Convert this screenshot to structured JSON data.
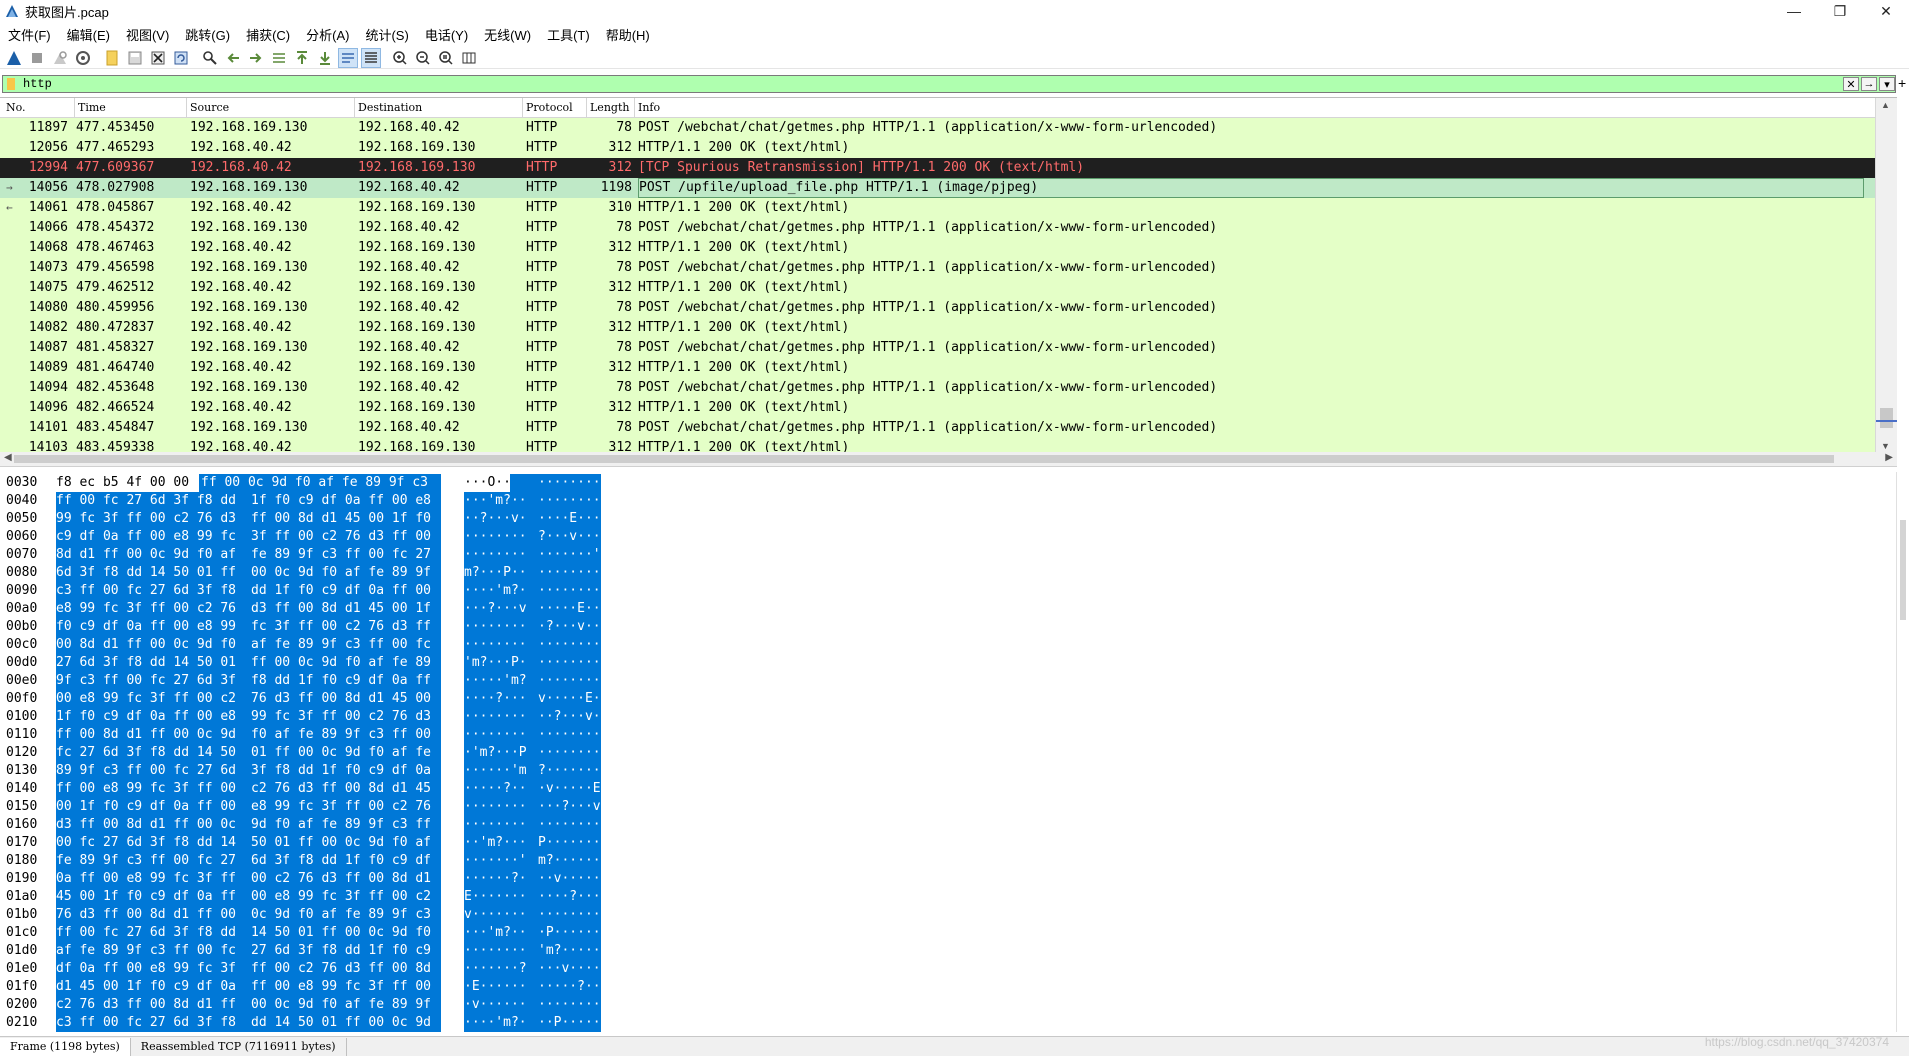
{
  "window": {
    "title": "获取图片.pcap",
    "controls": {
      "minimize": "—",
      "restore": "❐",
      "close": "✕"
    }
  },
  "menu": [
    "文件(F)",
    "编辑(E)",
    "视图(V)",
    "跳转(G)",
    "捕获(C)",
    "分析(A)",
    "统计(S)",
    "电话(Y)",
    "无线(W)",
    "工具(T)",
    "帮助(H)"
  ],
  "toolbar": {
    "icons": [
      "shark-fin-start-icon",
      "stop-icon",
      "restart-icon",
      "options-icon",
      "open-file-icon",
      "save-icon",
      "close-file-icon",
      "reload-icon",
      "find-icon",
      "go-back-icon",
      "go-forward-icon",
      "go-to-packet-icon",
      "first-packet-icon",
      "last-packet-icon",
      "autoscroll-icon",
      "colorize-icon",
      "zoom-in-icon",
      "zoom-out-icon",
      "zoom-normal-icon",
      "resize-columns-icon"
    ]
  },
  "filter": {
    "value": "http",
    "clear_icon": "✕",
    "apply_icon": "→"
  },
  "packet_list": {
    "columns": {
      "no": "No.",
      "time": "Time",
      "source": "Source",
      "destination": "Destination",
      "protocol": "Protocol",
      "length": "Length",
      "info": "Info"
    },
    "rows": [
      {
        "no": "11897",
        "time": "477.453450",
        "src": "192.168.169.130",
        "dst": "192.168.40.42",
        "proto": "HTTP",
        "len": "78",
        "info": "POST /webchat/chat/getmes.php HTTP/1.1  (application/x-www-form-urlencoded)"
      },
      {
        "no": "12056",
        "time": "477.465293",
        "src": "192.168.40.42",
        "dst": "192.168.169.130",
        "proto": "HTTP",
        "len": "312",
        "info": "HTTP/1.1 200 OK  (text/html)"
      },
      {
        "no": "12994",
        "time": "477.609367",
        "src": "192.168.40.42",
        "dst": "192.168.169.130",
        "proto": "HTTP",
        "len": "312",
        "info": "[TCP Spurious Retransmission] HTTP/1.1 200 OK  (text/html)"
      },
      {
        "no": "14056",
        "time": "478.027908",
        "src": "192.168.169.130",
        "dst": "192.168.40.42",
        "proto": "HTTP",
        "len": "1198",
        "info": "POST /upfile/upload_file.php HTTP/1.1  (image/pjpeg)"
      },
      {
        "no": "14061",
        "time": "478.045867",
        "src": "192.168.40.42",
        "dst": "192.168.169.130",
        "proto": "HTTP",
        "len": "310",
        "info": "HTTP/1.1 200 OK  (text/html)"
      },
      {
        "no": "14066",
        "time": "478.454372",
        "src": "192.168.169.130",
        "dst": "192.168.40.42",
        "proto": "HTTP",
        "len": "78",
        "info": "POST /webchat/chat/getmes.php HTTP/1.1  (application/x-www-form-urlencoded)"
      },
      {
        "no": "14068",
        "time": "478.467463",
        "src": "192.168.40.42",
        "dst": "192.168.169.130",
        "proto": "HTTP",
        "len": "312",
        "info": "HTTP/1.1 200 OK  (text/html)"
      },
      {
        "no": "14073",
        "time": "479.456598",
        "src": "192.168.169.130",
        "dst": "192.168.40.42",
        "proto": "HTTP",
        "len": "78",
        "info": "POST /webchat/chat/getmes.php HTTP/1.1  (application/x-www-form-urlencoded)"
      },
      {
        "no": "14075",
        "time": "479.462512",
        "src": "192.168.40.42",
        "dst": "192.168.169.130",
        "proto": "HTTP",
        "len": "312",
        "info": "HTTP/1.1 200 OK  (text/html)"
      },
      {
        "no": "14080",
        "time": "480.459956",
        "src": "192.168.169.130",
        "dst": "192.168.40.42",
        "proto": "HTTP",
        "len": "78",
        "info": "POST /webchat/chat/getmes.php HTTP/1.1  (application/x-www-form-urlencoded)"
      },
      {
        "no": "14082",
        "time": "480.472837",
        "src": "192.168.40.42",
        "dst": "192.168.169.130",
        "proto": "HTTP",
        "len": "312",
        "info": "HTTP/1.1 200 OK  (text/html)"
      },
      {
        "no": "14087",
        "time": "481.458327",
        "src": "192.168.169.130",
        "dst": "192.168.40.42",
        "proto": "HTTP",
        "len": "78",
        "info": "POST /webchat/chat/getmes.php HTTP/1.1  (application/x-www-form-urlencoded)"
      },
      {
        "no": "14089",
        "time": "481.464740",
        "src": "192.168.40.42",
        "dst": "192.168.169.130",
        "proto": "HTTP",
        "len": "312",
        "info": "HTTP/1.1 200 OK  (text/html)"
      },
      {
        "no": "14094",
        "time": "482.453648",
        "src": "192.168.169.130",
        "dst": "192.168.40.42",
        "proto": "HTTP",
        "len": "78",
        "info": "POST /webchat/chat/getmes.php HTTP/1.1  (application/x-www-form-urlencoded)"
      },
      {
        "no": "14096",
        "time": "482.466524",
        "src": "192.168.40.42",
        "dst": "192.168.169.130",
        "proto": "HTTP",
        "len": "312",
        "info": "HTTP/1.1 200 OK  (text/html)"
      },
      {
        "no": "14101",
        "time": "483.454847",
        "src": "192.168.169.130",
        "dst": "192.168.40.42",
        "proto": "HTTP",
        "len": "78",
        "info": "POST /webchat/chat/getmes.php HTTP/1.1  (application/x-www-form-urlencoded)"
      },
      {
        "no": "14103",
        "time": "483.459338",
        "src": "192.168.40.42",
        "dst": "192.168.169.130",
        "proto": "HTTP",
        "len": "312",
        "info": "HTTP/1.1 200 OK  (text/html)"
      }
    ]
  },
  "bytes": {
    "lines": [
      {
        "off": "0030",
        "pre": "f8 ec b5 4f 00 00",
        "h1": "",
        "h2": "ff 00  0c 9d f0 af fe 89 9f c3",
        "a1": "···O··",
        "a2": " ········"
      },
      {
        "off": "0040",
        "h1": "ff 00 fc 27 6d 3f f8 dd",
        "h2": "1f f0 c9 df 0a ff 00 e8",
        "a1": "···'m?··",
        "a2": " ········"
      },
      {
        "off": "0050",
        "h1": "99 fc 3f ff 00 c2 76 d3",
        "h2": "ff 00 8d d1 45 00 1f f0",
        "a1": "··?···v·",
        "a2": " ····E···"
      },
      {
        "off": "0060",
        "h1": "c9 df 0a ff 00 e8 99 fc",
        "h2": "3f ff 00 c2 76 d3 ff 00",
        "a1": "········",
        "a2": " ?···v···"
      },
      {
        "off": "0070",
        "h1": "8d d1 ff 00 0c 9d f0 af",
        "h2": "fe 89 9f c3 ff 00 fc 27",
        "a1": "········",
        "a2": " ·······'"
      },
      {
        "off": "0080",
        "h1": "6d 3f f8 dd 14 50 01 ff",
        "h2": "00 0c 9d f0 af fe 89 9f",
        "a1": "m?···P··",
        "a2": " ········"
      },
      {
        "off": "0090",
        "h1": "c3 ff 00 fc 27 6d 3f f8",
        "h2": "dd 1f f0 c9 df 0a ff 00",
        "a1": "····'m?·",
        "a2": " ········"
      },
      {
        "off": "00a0",
        "h1": "e8 99 fc 3f ff 00 c2 76",
        "h2": "d3 ff 00 8d d1 45 00 1f",
        "a1": "···?···v",
        "a2": " ·····E··"
      },
      {
        "off": "00b0",
        "h1": "f0 c9 df 0a ff 00 e8 99",
        "h2": "fc 3f ff 00 c2 76 d3 ff",
        "a1": "········",
        "a2": " ·?···v··"
      },
      {
        "off": "00c0",
        "h1": "00 8d d1 ff 00 0c 9d f0",
        "h2": "af fe 89 9f c3 ff 00 fc",
        "a1": "········",
        "a2": " ········"
      },
      {
        "off": "00d0",
        "h1": "27 6d 3f f8 dd 14 50 01",
        "h2": "ff 00 0c 9d f0 af fe 89",
        "a1": "'m?···P·",
        "a2": " ········"
      },
      {
        "off": "00e0",
        "h1": "9f c3 ff 00 fc 27 6d 3f",
        "h2": "f8 dd 1f f0 c9 df 0a ff",
        "a1": "·····'m?",
        "a2": " ········"
      },
      {
        "off": "00f0",
        "h1": "00 e8 99 fc 3f ff 00 c2",
        "h2": "76 d3 ff 00 8d d1 45 00",
        "a1": "····?···",
        "a2": " v·····E·"
      },
      {
        "off": "0100",
        "h1": "1f f0 c9 df 0a ff 00 e8",
        "h2": "99 fc 3f ff 00 c2 76 d3",
        "a1": "········",
        "a2": " ··?···v·"
      },
      {
        "off": "0110",
        "h1": "ff 00 8d d1 ff 00 0c 9d",
        "h2": "f0 af fe 89 9f c3 ff 00",
        "a1": "········",
        "a2": " ········"
      },
      {
        "off": "0120",
        "h1": "fc 27 6d 3f f8 dd 14 50",
        "h2": "01 ff 00 0c 9d f0 af fe",
        "a1": "·'m?···P",
        "a2": " ········"
      },
      {
        "off": "0130",
        "h1": "89 9f c3 ff 00 fc 27 6d",
        "h2": "3f f8 dd 1f f0 c9 df 0a",
        "a1": "······'m",
        "a2": " ?·······"
      },
      {
        "off": "0140",
        "h1": "ff 00 e8 99 fc 3f ff 00",
        "h2": "c2 76 d3 ff 00 8d d1 45",
        "a1": "·····?··",
        "a2": " ·v·····E"
      },
      {
        "off": "0150",
        "h1": "00 1f f0 c9 df 0a ff 00",
        "h2": "e8 99 fc 3f ff 00 c2 76",
        "a1": "········",
        "a2": " ···?···v"
      },
      {
        "off": "0160",
        "h1": "d3 ff 00 8d d1 ff 00 0c",
        "h2": "9d f0 af fe 89 9f c3 ff",
        "a1": "········",
        "a2": " ········"
      },
      {
        "off": "0170",
        "h1": "00 fc 27 6d 3f f8 dd 14",
        "h2": "50 01 ff 00 0c 9d f0 af",
        "a1": "··'m?···",
        "a2": " P·······"
      },
      {
        "off": "0180",
        "h1": "fe 89 9f c3 ff 00 fc 27",
        "h2": "6d 3f f8 dd 1f f0 c9 df",
        "a1": "·······'",
        "a2": " m?······"
      },
      {
        "off": "0190",
        "h1": "0a ff 00 e8 99 fc 3f ff",
        "h2": "00 c2 76 d3 ff 00 8d d1",
        "a1": "······?·",
        "a2": " ··v·····"
      },
      {
        "off": "01a0",
        "h1": "45 00 1f f0 c9 df 0a ff",
        "h2": "00 e8 99 fc 3f ff 00 c2",
        "a1": "E·······",
        "a2": " ····?···"
      },
      {
        "off": "01b0",
        "h1": "76 d3 ff 00 8d d1 ff 00",
        "h2": "0c 9d f0 af fe 89 9f c3",
        "a1": "v·······",
        "a2": " ········"
      },
      {
        "off": "01c0",
        "h1": "ff 00 fc 27 6d 3f f8 dd",
        "h2": "14 50 01 ff 00 0c 9d f0",
        "a1": "···'m?··",
        "a2": " ·P······"
      },
      {
        "off": "01d0",
        "h1": "af fe 89 9f c3 ff 00 fc",
        "h2": "27 6d 3f f8 dd 1f f0 c9",
        "a1": "········",
        "a2": " 'm?·····"
      },
      {
        "off": "01e0",
        "h1": "df 0a ff 00 e8 99 fc 3f",
        "h2": "ff 00 c2 76 d3 ff 00 8d",
        "a1": "·······?",
        "a2": " ···v····"
      },
      {
        "off": "01f0",
        "h1": "d1 45 00 1f f0 c9 df 0a",
        "h2": "ff 00 e8 99 fc 3f ff 00",
        "a1": "·E······",
        "a2": " ·····?··"
      },
      {
        "off": "0200",
        "h1": "c2 76 d3 ff 00 8d d1 ff",
        "h2": "00 0c 9d f0 af fe 89 9f",
        "a1": "·v······",
        "a2": " ········"
      },
      {
        "off": "0210",
        "h1": "c3 ff 00 fc 27 6d 3f f8",
        "h2": "dd 14 50 01 ff 00 0c 9d",
        "a1": "····'m?·",
        "a2": " ··P·····"
      }
    ]
  },
  "status": {
    "tabs": [
      "Frame (1198 bytes)",
      "Reassembled TCP (7116911 bytes)"
    ],
    "watermark": "https://blog.csdn.net/qq_37420374"
  },
  "colors": {
    "filter_bg": "#afffaf",
    "list_bg": "#e4ffc7",
    "selected_dark": "#1f1f1f",
    "retrans_text": "#ff6b6b",
    "highlight": "#0078d7"
  }
}
